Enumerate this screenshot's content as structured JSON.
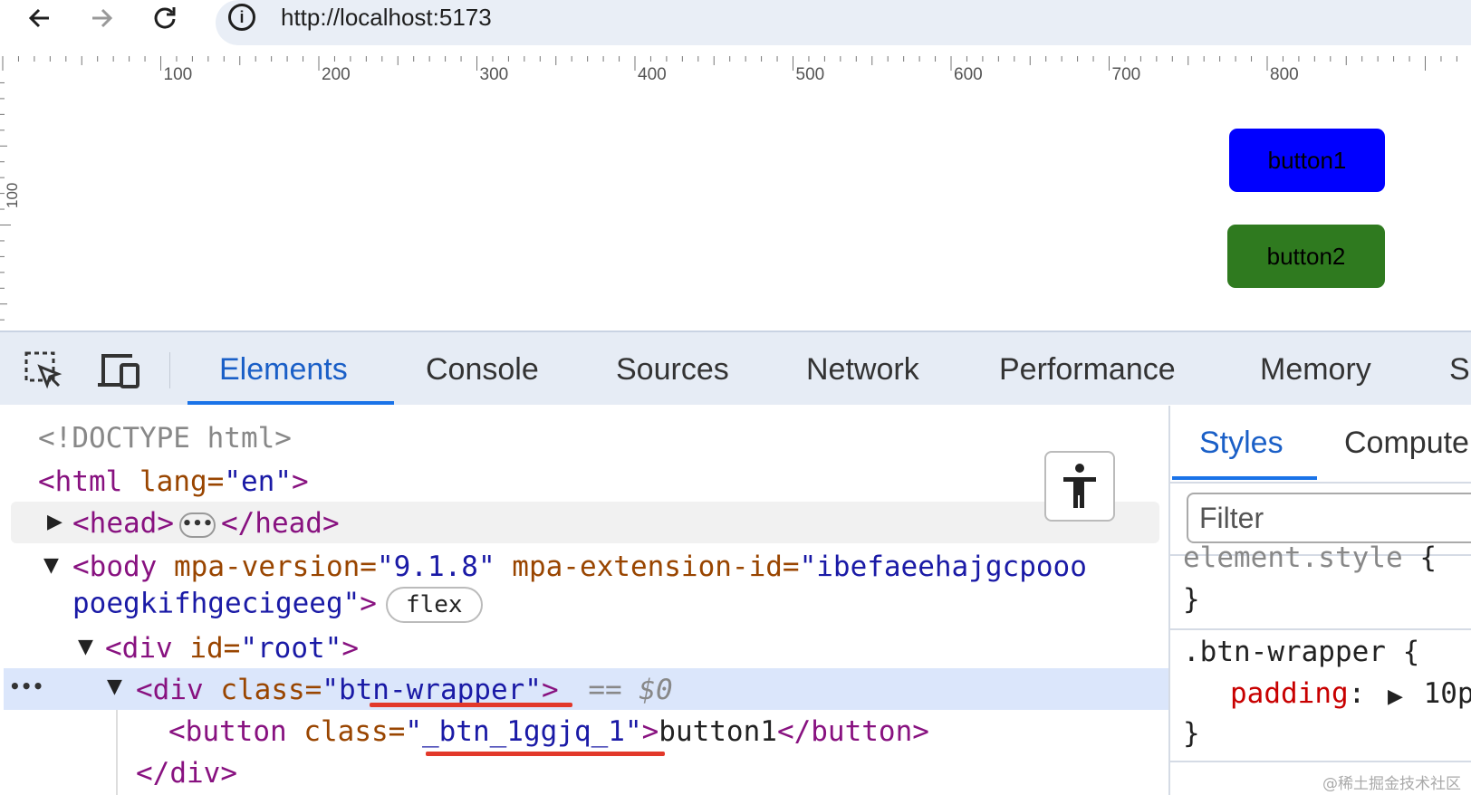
{
  "browser": {
    "url": "http://localhost:5173",
    "back_icon": "arrow-left-icon",
    "forward_icon": "arrow-right-icon",
    "reload_icon": "reload-icon",
    "site_info_icon": "info-icon"
  },
  "rulers": {
    "horizontal_labels": [
      "100",
      "200",
      "300",
      "400",
      "500",
      "600",
      "700",
      "800"
    ],
    "vertical_labels": [
      "100"
    ]
  },
  "page": {
    "button1": {
      "label": "button1",
      "color": "#0000ff"
    },
    "button2": {
      "label": "button2",
      "color": "#2f7a1f"
    }
  },
  "devtools": {
    "toolbar_icons": [
      "inspect-element-icon",
      "device-toggle-icon"
    ],
    "tabs": [
      "Elements",
      "Console",
      "Sources",
      "Network",
      "Performance",
      "Memory",
      "S"
    ],
    "active_tab": "Elements",
    "dom": {
      "doctype": "<!DOCTYPE html>",
      "html_open": "<html",
      "html_attr": "lang=",
      "html_val": "\"en\"",
      "html_close": ">",
      "head_open": "<head>",
      "head_dots": "•••",
      "head_close": "</head>",
      "body_open": "<body",
      "body_attr1": "mpa-version=",
      "body_val1": "\"9.1.8\"",
      "body_attr2": "mpa-extension-id=",
      "body_val2a": "\"ibefaeehajgcpooo",
      "body_val2b": "poegkifhgecigeeg\"",
      "body_close": ">",
      "flex_badge": "flex",
      "root_open": "<div",
      "root_attr": "id=",
      "root_val": "\"root\"",
      "root_close": ">",
      "wrapper_open": "<div",
      "wrapper_attr": "class=",
      "wrapper_val_q1": "\"",
      "wrapper_val": "btn-wrapper",
      "wrapper_val_q2": "\"",
      "wrapper_close": ">",
      "wrapper_eq": "==",
      "wrapper_ref": "$0",
      "selected_dots": "•••",
      "button_open": "<button",
      "button_attr": "class=",
      "button_val": "\"_btn_1ggjq_1\"",
      "button_close": ">",
      "button_text": "button1",
      "button_end": "</button>",
      "div_end": "</div>"
    },
    "accessibility_icon": "accessibility-icon",
    "styles_panel": {
      "tabs": [
        "Styles",
        "Compute"
      ],
      "active_tab": "Styles",
      "filter_placeholder": "Filter",
      "rule1_selector": "element.style",
      "rule1_open": "{",
      "rule1_close": "}",
      "rule2_selector": ".btn-wrapper",
      "rule2_open": "{",
      "rule2_prop": "padding",
      "rule2_colon": ":",
      "rule2_value": "10p",
      "rule2_close": "}"
    }
  },
  "watermark": "@稀土掘金技术社区"
}
